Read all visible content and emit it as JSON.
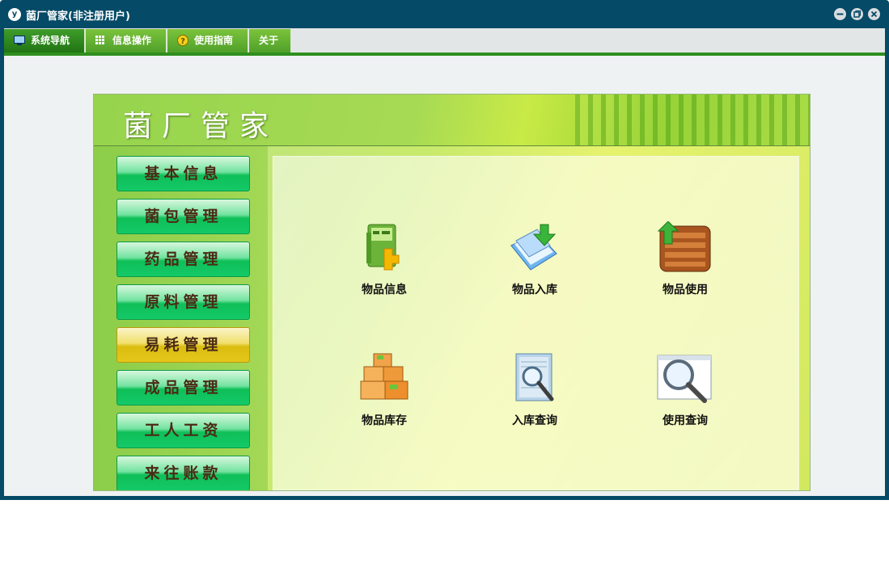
{
  "window": {
    "title": "菌厂管家(非注册用户)",
    "app_icon_text": "y"
  },
  "menu": [
    {
      "label": "系统导航",
      "icon": "monitor-icon"
    },
    {
      "label": "信息操作",
      "icon": "grid-icon"
    },
    {
      "label": "使用指南",
      "icon": "help-icon"
    },
    {
      "label": "关于",
      "icon": ""
    }
  ],
  "banner": {
    "title": "菌厂管家"
  },
  "sidebar": {
    "items": [
      "基本信息",
      "菌包管理",
      "药品管理",
      "原料管理",
      "易耗管理",
      "成品管理",
      "工人工资",
      "来往账款"
    ],
    "selected": "易耗管理"
  },
  "tiles": [
    {
      "label": "物品信息",
      "icon": "folder-info-icon"
    },
    {
      "label": "物品入库",
      "icon": "stock-in-icon"
    },
    {
      "label": "物品使用",
      "icon": "crate-use-icon"
    },
    {
      "label": "物品库存",
      "icon": "boxes-inventory-icon"
    },
    {
      "label": "入库查询",
      "icon": "document-search-icon"
    },
    {
      "label": "使用查询",
      "icon": "window-search-icon"
    }
  ],
  "colors": {
    "titlebar": "#054a67",
    "menu_active": "#217414",
    "nav_selected": "#dbbd10"
  }
}
